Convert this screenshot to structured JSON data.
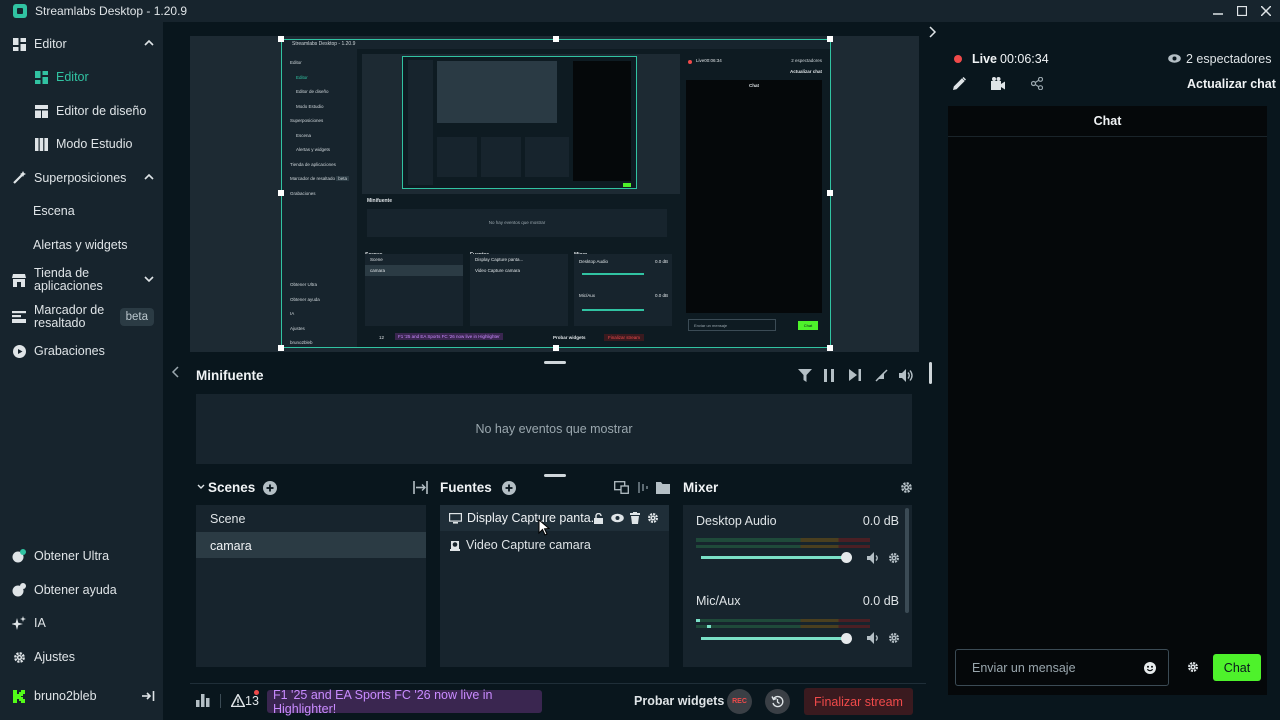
{
  "window": {
    "title": "Streamlabs Desktop - 1.20.9"
  },
  "sidebar": {
    "editor": "Editor",
    "editor_sub": "Editor",
    "layout_editor": "Editor de diseño",
    "studio_mode": "Modo Estudio",
    "overlays": "Superposiciones",
    "scene": "Escena",
    "alerts": "Alertas y widgets",
    "app_store_l1": "Tienda de",
    "app_store_l2": "aplicaciones",
    "highlighter_l1": "Marcador de",
    "highlighter_l2": "resaltado",
    "beta": "beta",
    "recordings": "Grabaciones",
    "get_ultra": "Obtener Ultra",
    "get_help": "Obtener ayuda",
    "ai": "IA",
    "settings": "Ajustes",
    "user": "bruno2bleb"
  },
  "minifuente": {
    "title": "Minifuente",
    "empty": "No hay eventos que mostrar"
  },
  "scenes": {
    "title": "Scenes",
    "items": [
      "Scene",
      "camara"
    ],
    "selected": 1
  },
  "sources": {
    "title": "Fuentes",
    "items": [
      "Display Capture panta...",
      "Video Capture camara"
    ]
  },
  "mixer": {
    "title": "Mixer",
    "channels": [
      {
        "name": "Desktop Audio",
        "db": "0.0 dB",
        "volume": 0.98
      },
      {
        "name": "Mic/Aux",
        "db": "0.0 dB",
        "volume": 0.98
      }
    ]
  },
  "footer": {
    "alerts_count": "13",
    "banner": "F1 '25 and EA Sports FC '26 now live in Highlighter!",
    "test_widgets": "Probar widgets",
    "rec": "REC",
    "end_stream": "Finalizar stream"
  },
  "chat": {
    "live": "Live",
    "time": "00:06:34",
    "viewers": "2 espectadores",
    "refresh": "Actualizar chat",
    "header": "Chat",
    "placeholder": "Enviar un mensaje",
    "send": "Chat"
  },
  "preview": {
    "title": "Streamlabs Desktop - 1.20.9",
    "nav": [
      "Editor",
      "Editor",
      "Editor de diseño",
      "Modo Estudio",
      "Superposiciones",
      "Escena",
      "Alertas y widgets",
      "Tienda de aplicaciones",
      "Marcador de resaltado",
      "Grabaciones"
    ],
    "beta": "beta",
    "bottom_nav": [
      "Obtener Ultra",
      "Obtener ayuda",
      "IA",
      "Ajustes",
      "bruno2bleb"
    ],
    "live": "Live00:06:34",
    "viewers": "2 espectadores",
    "refresh": "Actualizar chat",
    "chat_header": "Chat",
    "minifuente": "Minifuente",
    "empty": "No hay eventos que mostrar",
    "scenes": "Scenes",
    "scene_items": [
      "Scene",
      "camara"
    ],
    "sources": "Fuentes",
    "source_items": [
      "Display Capture panta...",
      "Video Capture camara"
    ],
    "mixer": "Mixer",
    "channels": [
      "Desktop Audio",
      "Mic/Aux"
    ],
    "db": "0.0 dB",
    "alerts": "12",
    "banner": "F1 '25 and EA Sports FC '26 now live in Highlighter",
    "test_widgets": "Probar widgets",
    "end_stream": "Finalizar stream",
    "chat_placeholder": "Enviar un mensaje",
    "chat_send": "Chat"
  },
  "colors": {
    "accent": "#31c3a2",
    "live": "#f04a4a",
    "chat_button": "#4ef22b",
    "banner_text": "#c98bff"
  }
}
